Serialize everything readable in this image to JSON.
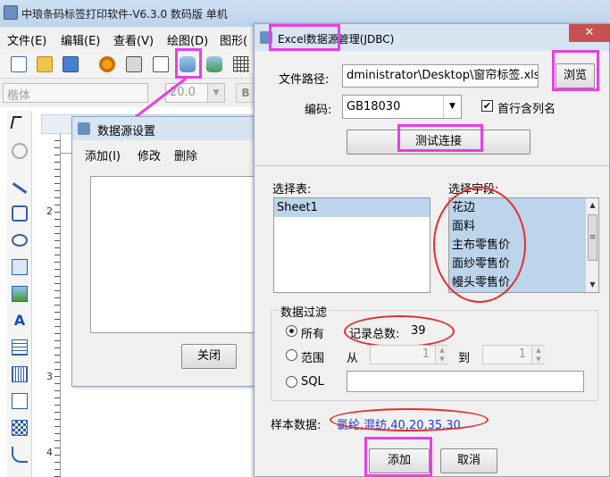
{
  "app": {
    "title": "中琅条码标签打印软件-V6.3.0 数码版 单机",
    "menus": [
      "文件(E)",
      "编辑(E)",
      "查看(V)",
      "绘图(D)",
      "图形("
    ],
    "font_name": "楷体",
    "font_size": "20.0",
    "font_size_arrow": "▼",
    "bold_label": "B",
    "ruler_marks": [
      "2",
      "3",
      "4"
    ],
    "toolbar_icons": [
      "new-icon",
      "open-icon",
      "save-icon",
      "settings-icon",
      "print-icon",
      "print-preview-icon",
      "database-icon",
      "database-link-icon",
      "grid-icon"
    ],
    "left_tool_icons": [
      "pointer-icon",
      "rotate-icon",
      "line-icon",
      "rectangle-icon",
      "ellipse-icon",
      "image-frame-icon",
      "picture-icon",
      "text-icon",
      "rich-text-icon",
      "barcode-icon",
      "shape-icon",
      "qrcode-icon",
      "curve-icon"
    ]
  },
  "data_source_dialog": {
    "title": "数据源设置",
    "menu": [
      "添加(I)",
      "修改",
      "删除"
    ],
    "close_button": "关闭"
  },
  "excel_dialog": {
    "title": "Excel数据源管理(JDBC)",
    "close_symbol": "✕",
    "file_path_label": "文件路径:",
    "file_path_value": "dministrator\\Desktop\\窗帘标签.xlsx",
    "browse_button": "浏览",
    "encoding_label": "编码:",
    "encoding_value": "GB18030",
    "encoding_arrow": "▼",
    "first_row_checkbox_label": "首行含列名",
    "first_row_checked": "✔",
    "test_connection_button": "测试连接",
    "select_table_label": "选择表:",
    "tables": [
      "Sheet1"
    ],
    "select_fields_label": "选择字段:",
    "fields": [
      "花边",
      "面料",
      "主布零售价",
      "面纱零售价",
      "幔头零售价"
    ],
    "scroll_up": "▲",
    "scroll_down": "▼",
    "scroll_grip": "≡",
    "filter_group_label": "数据过滤",
    "filter_all_label": "所有",
    "record_count_label": "记录总数:",
    "record_count_value": "39",
    "filter_range_label": "范围",
    "range_from_label": "从",
    "range_from_value": "1",
    "range_to_label": "到",
    "range_to_value": "1",
    "spin_up": "▲",
    "spin_down": "▼",
    "filter_sql_label": "SQL",
    "sample_label": "样本数据:",
    "sample_value": "氯纶,混纺,40,20,35,30",
    "add_button": "添加",
    "cancel_button": "取消"
  }
}
